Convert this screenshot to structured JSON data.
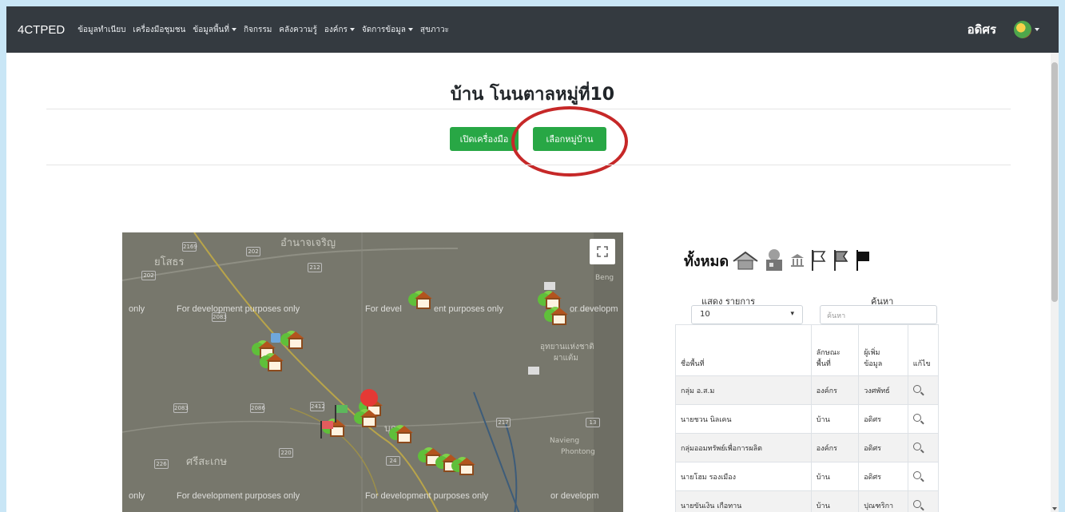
{
  "navbar": {
    "brand": "4CTPED",
    "items": [
      {
        "label": "ข้อมูลทำเนียบ",
        "dropdown": false
      },
      {
        "label": "เครื่องมือชุมชน",
        "dropdown": false
      },
      {
        "label": "ข้อมูลพื้นที่",
        "dropdown": true
      },
      {
        "label": "กิจกรรม",
        "dropdown": false
      },
      {
        "label": "คลังความรู้",
        "dropdown": false
      },
      {
        "label": "องค์กร",
        "dropdown": true
      },
      {
        "label": "จัดการข้อมูล",
        "dropdown": true
      },
      {
        "label": "สุขภาวะ",
        "dropdown": false
      }
    ],
    "user": "อดิศร",
    "avatar_icon": "user-avatar-icon"
  },
  "page": {
    "title": "บ้าน โนนตาลหมู่ที่10",
    "open_tools_button": "เปิดเครื่องมือ",
    "select_village_button": "เลือกหมู่บ้าน"
  },
  "map": {
    "watermark": "For development purposes only",
    "watermark_fragments": [
      "only",
      "For development purposes only",
      "For devel",
      "ent purposes only",
      "or developm"
    ],
    "place_labels": [
      "อำนาจเจริญ",
      "ยโสธร",
      "ศรีสะเกษ",
      "อุทยานแห่งชาติ",
      "ผาแต้ม",
      "Beng",
      "Navieng",
      "Phontong",
      "บุณ"
    ],
    "road_shields": [
      "2169",
      "202",
      "212",
      "202",
      "2083",
      "2083",
      "2086",
      "2412",
      "217",
      "13",
      "226",
      "220",
      "24"
    ],
    "fullscreen_icon": "fullscreen-icon"
  },
  "panel": {
    "title": "ทั้งหมด",
    "legend_icons": [
      "house-icon",
      "community-icon",
      "government-building-icon",
      "white-flag-icon",
      "gray-flag-icon",
      "black-flag-icon"
    ],
    "show_label": "แสดง รายการ",
    "search_label": "ค้นหา",
    "page_size": "10",
    "search_placeholder": "ค้นหา",
    "columns": [
      "ชื่อพื้นที่",
      "ลักษณะพื้นที่",
      "ผู้เพิ่มข้อมูล",
      "แก้ไข"
    ],
    "column_lines": [
      [
        "ชื่อพื้นที่"
      ],
      [
        "ลักษณะ",
        "พื้นที่"
      ],
      [
        "ผู้เพิ่ม",
        "ข้อมูล"
      ],
      [
        "แก้ไข"
      ]
    ],
    "rows": [
      {
        "name": "กลุ่ม อ.ส.ม",
        "type": "องค์กร",
        "added_by": "วงศพัทธ์"
      },
      {
        "name": "นายชวน นิลเคน",
        "type": "บ้าน",
        "added_by": "อดิศร"
      },
      {
        "name": "กลุ่มออมทรัพย์เพื่อการผลิต",
        "type": "องค์กร",
        "added_by": "อดิศร"
      },
      {
        "name": "นายโฮม รองเมือง",
        "type": "บ้าน",
        "added_by": "อดิศร"
      },
      {
        "name": "นายขันเงิน เกือทาน",
        "type": "บ้าน",
        "added_by": "ปุณฑริกา"
      }
    ]
  },
  "colors": {
    "navbar": "#343a40",
    "button": "#28a745",
    "highlight": "#c62828"
  }
}
